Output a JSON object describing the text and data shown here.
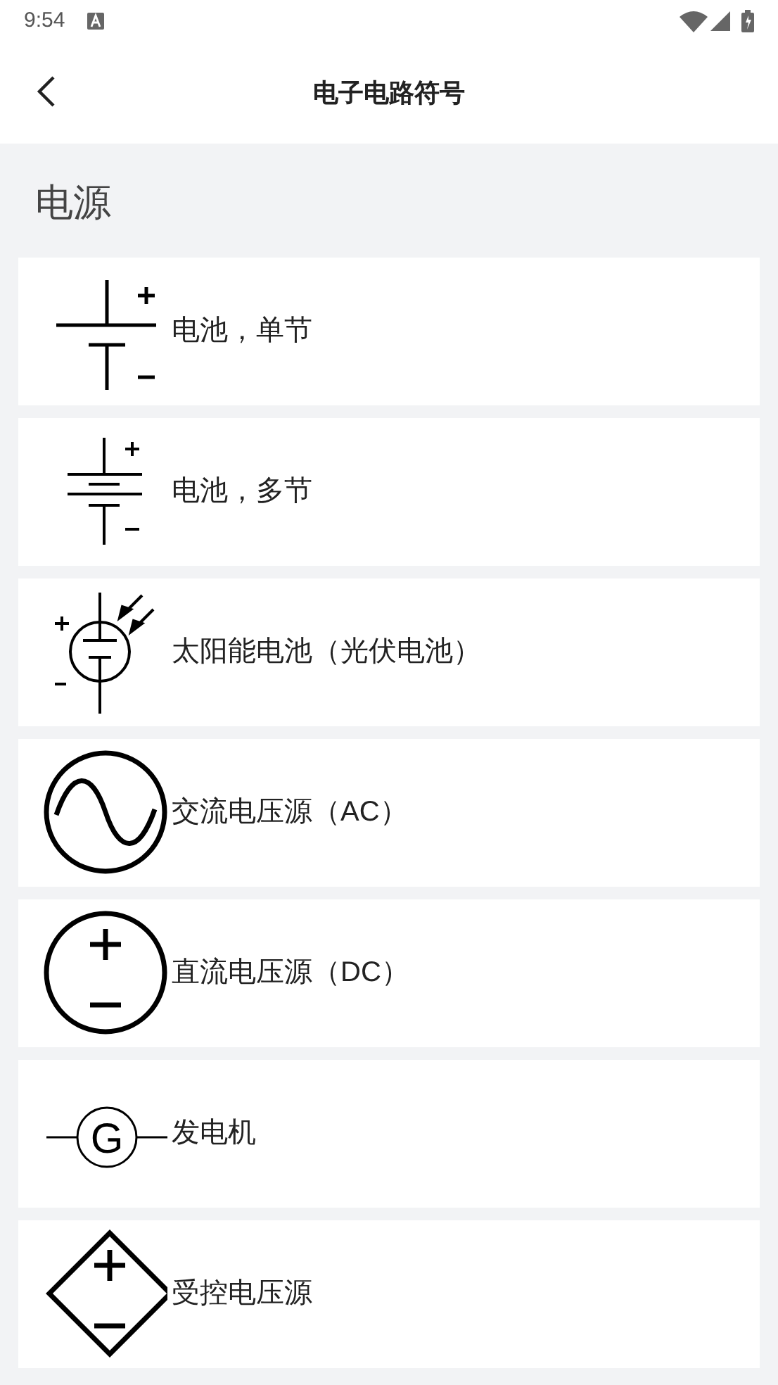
{
  "status_bar": {
    "time": "9:54"
  },
  "header": {
    "title": "电子电路符号"
  },
  "section": {
    "title": "电源"
  },
  "items": [
    {
      "kind": "battery_single",
      "label": "电池，单节"
    },
    {
      "kind": "battery_multi",
      "label": "电池，多节"
    },
    {
      "kind": "solar_cell",
      "label": "太阳能电池（光伏电池）"
    },
    {
      "kind": "ac_source",
      "label": "交流电压源（AC）"
    },
    {
      "kind": "dc_source",
      "label": "直流电压源（DC）"
    },
    {
      "kind": "generator",
      "label": "发电机",
      "symbol_text": "G"
    },
    {
      "kind": "controlled_source",
      "label": "受控电压源"
    }
  ]
}
